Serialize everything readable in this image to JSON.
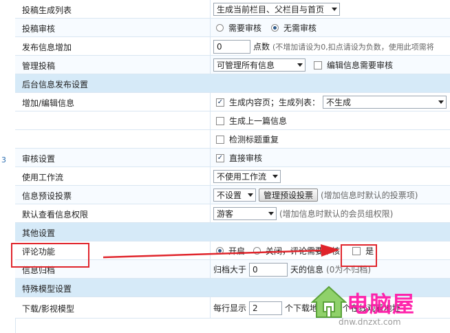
{
  "side": {
    "number": "3"
  },
  "rows": {
    "r1": {
      "label": "投稿生成列表",
      "select": "生成当前栏目、父栏目与首页"
    },
    "r2": {
      "label": "投稿审核",
      "opt1": "需要审核",
      "opt2": "无需审核"
    },
    "r3": {
      "label": "发布信息增加",
      "value": "0",
      "unit": "点数",
      "hint": "(不增加请设为0,扣点请设为负数，使用此项需将"
    },
    "r4": {
      "label": "管理投稿",
      "select": "可管理所有信息",
      "check": "编辑信息需要审核"
    },
    "r5": {
      "label": "后台信息发布设置"
    },
    "r6": {
      "label": "增加/编辑信息",
      "check": "生成内容页；生成列表：",
      "select": "不生成"
    },
    "r7": {
      "check": "生成上一篇信息"
    },
    "r8": {
      "check": "检测标题重复"
    },
    "r9": {
      "label": "审核设置",
      "check": "直接审核"
    },
    "r10": {
      "label": "使用工作流",
      "select": "不使用工作流"
    },
    "r11": {
      "label": "信息预设投票",
      "select": "不设置",
      "button": "管理预设投票",
      "hint": "(增加信息时默认的投票项)"
    },
    "r12": {
      "label": "默认查看信息权限",
      "select": "游客",
      "hint": "(增加信息时默认的会员组权限)"
    },
    "r13": {
      "label": "其他设置"
    },
    "r14": {
      "label": "评论功能",
      "opt1": "开启",
      "opt2": "关闭，评论需要审核:",
      "check": "是"
    },
    "r15": {
      "label": "信息归档",
      "prefix": "归档大于",
      "value": "0",
      "suffix": "天的信息",
      "hint": "(0为不归档)"
    },
    "r16": {
      "label": "特殊模型设置"
    },
    "r17": {
      "label": "下载/影视模型",
      "prefix": "每行显示",
      "value": "2",
      "suffix": "个下载地址，2",
      "trail": "个在线观看地址"
    }
  },
  "watermark": {
    "text": "电脑屋",
    "url": "dnw.dnzxt.com",
    "color": "#ff1aa8"
  },
  "colors": {
    "annotation": "#e0242b",
    "section": "#d6eaf8"
  }
}
